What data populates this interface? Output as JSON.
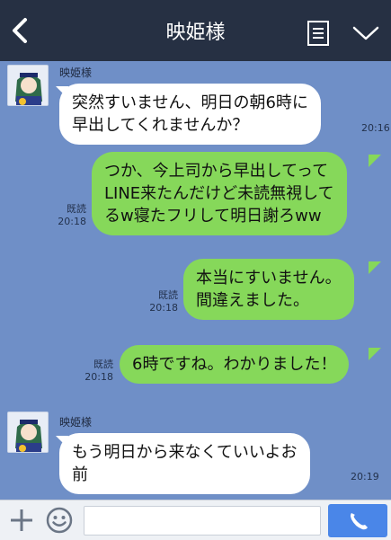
{
  "header": {
    "title": "映姫様",
    "icons": {
      "back": "chevron-left-icon",
      "menu": "notes-icon",
      "collapse": "chevron-down-icon"
    }
  },
  "messages": [
    {
      "direction": "incoming",
      "sender": "映姫様",
      "lines": [
        "突然すいません、明日の朝6時に",
        "早出してくれませんか？"
      ],
      "time": "20:16"
    },
    {
      "direction": "outgoing",
      "read": "既読",
      "lines": [
        "つか、今上司から早出してって",
        "LINE来たんだけど未読無視して",
        "るw寝たフリして明日謝ろww"
      ],
      "time": "20:18"
    },
    {
      "direction": "outgoing",
      "read": "既読",
      "lines": [
        "本当にすいません。",
        "間違えました。"
      ],
      "time": "20:18"
    },
    {
      "direction": "outgoing",
      "read": "既読",
      "lines": [
        "6時ですね。わかりました！"
      ],
      "time": "20:18"
    },
    {
      "direction": "incoming",
      "sender": "映姫様",
      "lines": [
        "もう明日から来なくていいよお",
        "前"
      ],
      "time": "20:19"
    }
  ],
  "input": {
    "value": "",
    "placeholder": ""
  },
  "colors": {
    "header": "#263043",
    "chat_background": "#6f8fc7",
    "incoming_bubble": "#ffffff",
    "outgoing_bubble": "#86d85a",
    "call_button": "#4a86e8"
  }
}
